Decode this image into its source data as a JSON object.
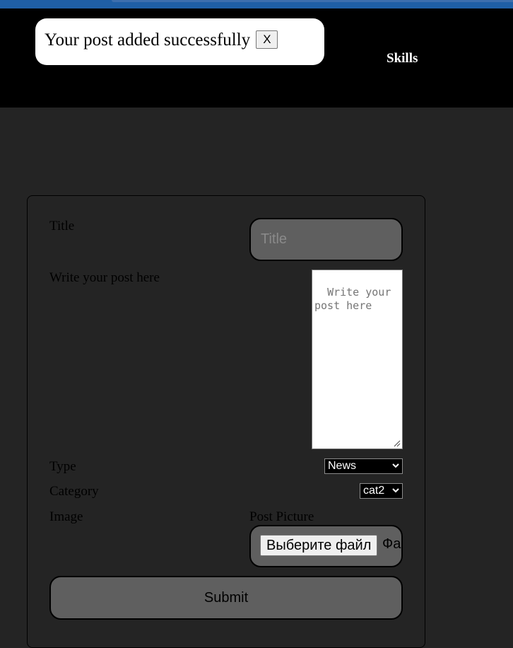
{
  "browser": {
    "accent": "#1f5fa6"
  },
  "notification": {
    "message": "Your post added successfully",
    "close_label": "X"
  },
  "nav": {
    "skills_label": "Skills"
  },
  "form": {
    "title_label": "Title",
    "title_placeholder": "Title",
    "post_label": "Write your post here",
    "post_placeholder": "Write your post here",
    "type_label": "Type",
    "type_value": "News",
    "category_label": "Category",
    "category_value": "cat2",
    "image_label": "Image",
    "picture_label": "Post Picture",
    "file_button_label": "Выберите файл",
    "file_status": "Файл не выбран",
    "submit_label": "Submit"
  },
  "colors": {
    "page_bg": "#242424",
    "header_bg": "#000000",
    "input_bg": "#5f5f5f",
    "toast_bg": "#ffffff"
  },
  "icons": {
    "select_arrow": "chevron-down-icon",
    "textarea_resize": "resize-handle-icon"
  }
}
